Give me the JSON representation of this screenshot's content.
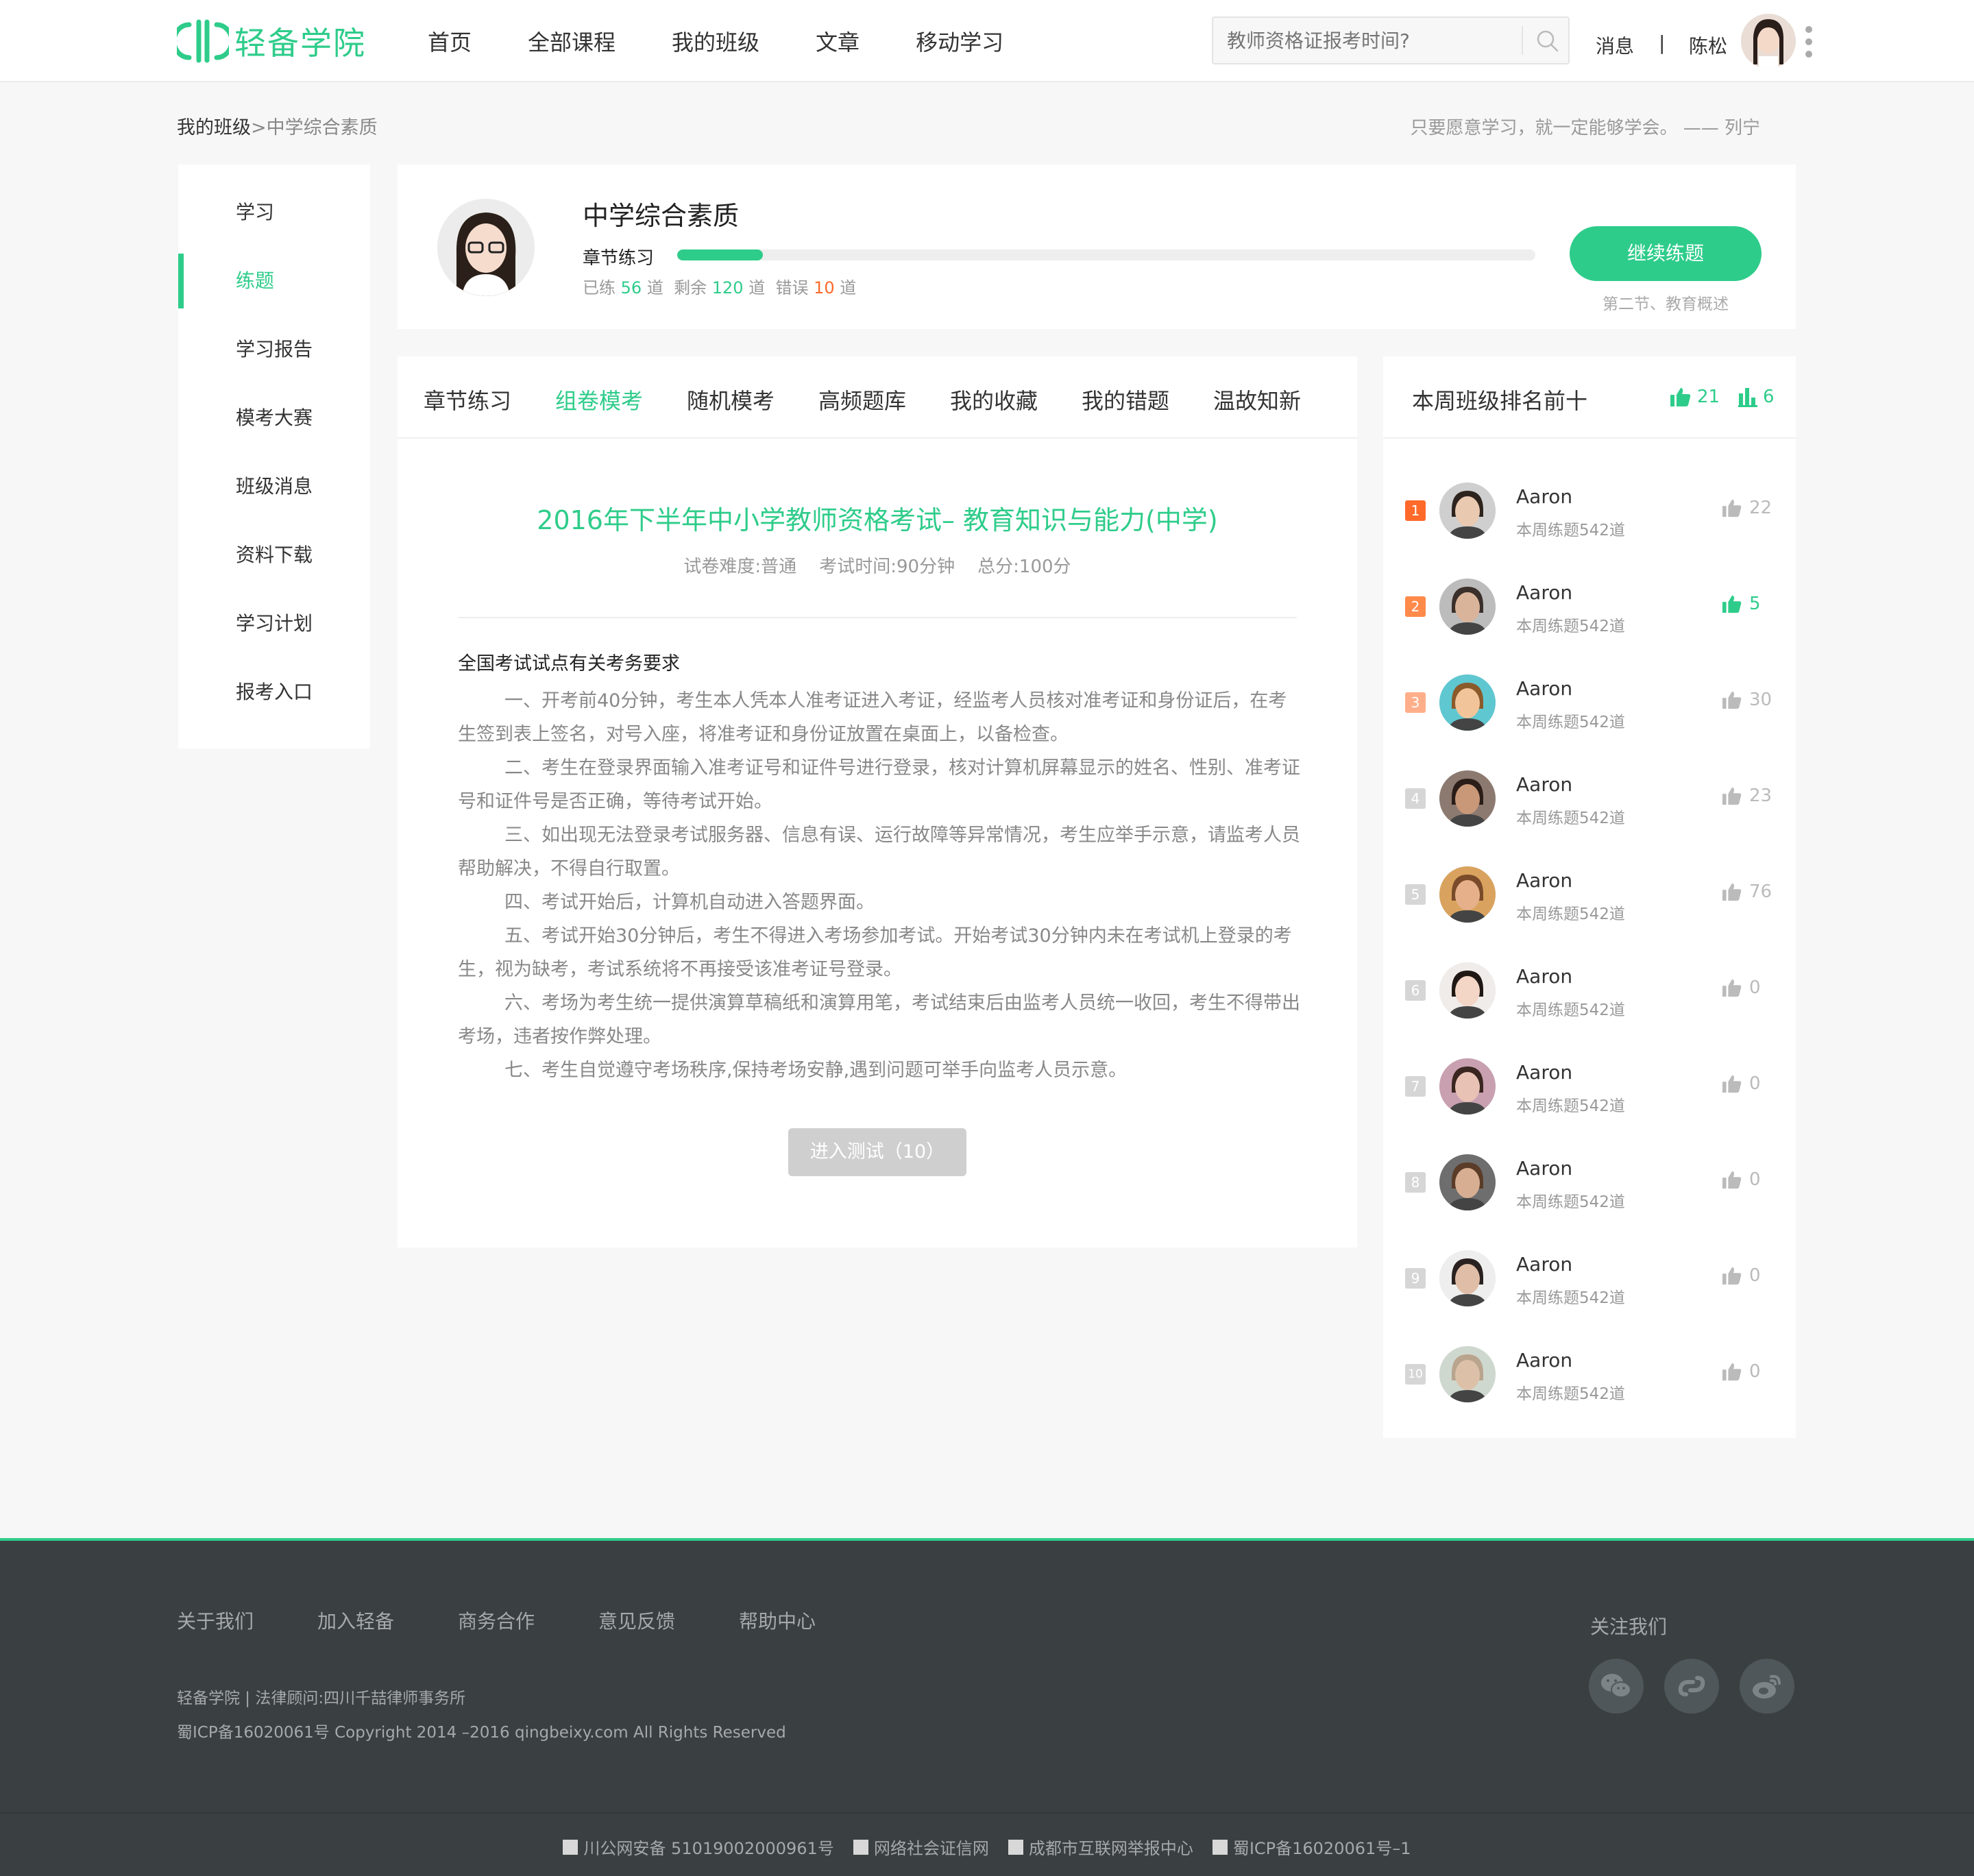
{
  "brand": {
    "name": "轻备学院",
    "color": "#2ecc8a"
  },
  "nav": {
    "items": [
      "首页",
      "全部课程",
      "我的班级",
      "文章",
      "移动学习"
    ]
  },
  "search": {
    "placeholder": "教师资格证报考时间?"
  },
  "header_user": {
    "messages": "消息",
    "separator": "|",
    "username": "陈松"
  },
  "breadcrumb": {
    "parent": "我的班级",
    "arrow": ">",
    "current": "中学综合素质"
  },
  "quote": "只要愿意学习，就一定能够学会。 —— 列宁",
  "sidebar": {
    "items": [
      "学习",
      "练题",
      "学习报告",
      "模考大赛",
      "班级消息",
      "资料下载",
      "学习计划",
      "报考入口"
    ],
    "active_index": 1
  },
  "course": {
    "title": "中学综合素质",
    "section_label": "章节练习",
    "progress_fraction": 0.1,
    "stats": {
      "done_label": "已练",
      "done": "56",
      "remain_label": "剩余",
      "remain": "120",
      "wrong_label": "错误",
      "wrong": "10",
      "unit": "道"
    },
    "continue_button": "继续练题",
    "hint": "第二节、教育概述"
  },
  "tabs": {
    "items": [
      "章节练习",
      "组卷模考",
      "随机模考",
      "高频题库",
      "我的收藏",
      "我的错题",
      "温故知新"
    ],
    "active_index": 1
  },
  "exam": {
    "title": "2016年下半年中小学教师资格考试– 教育知识与能力(中学)",
    "difficulty": "试卷难度:普通",
    "duration": "考试时间:90分钟",
    "total": "总分:100分",
    "notice_title": "全国考试试点有关考务要求",
    "notice_paragraphs": [
      "一、开考前40分钟，考生本人凭本人准考证进入考证，经监考人员核对准考证和身份证后，在考生签到表上签名，对号入座，将准考证和身份证放置在桌面上，以备检查。",
      "二、考生在登录界面输入准考证号和证件号进行登录，核对计算机屏幕显示的姓名、性别、准考证号和证件号是否正确，等待考试开始。",
      "三、如出现无法登录考试服务器、信息有误、运行故障等异常情况，考生应举手示意，请监考人员帮助解决，不得自行取置。",
      "四、考试开始后，计算机自动进入答题界面。",
      "五、考试开始30分钟后，考生不得进入考场参加考试。开始考试30分钟内未在考试机上登录的考生，视为缺考，考试系统将不再接受该准考证号登录。",
      "六、考场为考生统一提供演算草稿纸和演算用笔，考试结束后由监考人员统一收回，考生不得带出考场，违者按作弊处理。",
      "七、考生自觉遵守考场秩序,保持考场安静,遇到问题可举手向监考人员示意。"
    ],
    "enter_button": "进入测试（10）"
  },
  "ranking": {
    "title": "本周班级排名前十",
    "likes": "21",
    "rank_num": "6",
    "rows": [
      {
        "rank": "1",
        "name": "Aaron",
        "sub": "本周练题542道",
        "likes": "22",
        "liked": false,
        "badge_color": "#ff6a2a"
      },
      {
        "rank": "2",
        "name": "Aaron",
        "sub": "本周练题542道",
        "likes": "5",
        "liked": true,
        "badge_color": "#ff8a4a"
      },
      {
        "rank": "3",
        "name": "Aaron",
        "sub": "本周练题542道",
        "likes": "30",
        "liked": false,
        "badge_color": "#ffae8a"
      },
      {
        "rank": "4",
        "name": "Aaron",
        "sub": "本周练题542道",
        "likes": "23",
        "liked": false,
        "badge_color": "#d6d6d6"
      },
      {
        "rank": "5",
        "name": "Aaron",
        "sub": "本周练题542道",
        "likes": "76",
        "liked": false,
        "badge_color": "#d6d6d6"
      },
      {
        "rank": "6",
        "name": "Aaron",
        "sub": "本周练题542道",
        "likes": "0",
        "liked": false,
        "badge_color": "#d6d6d6"
      },
      {
        "rank": "7",
        "name": "Aaron",
        "sub": "本周练题542道",
        "likes": "0",
        "liked": false,
        "badge_color": "#d6d6d6"
      },
      {
        "rank": "8",
        "name": "Aaron",
        "sub": "本周练题542道",
        "likes": "0",
        "liked": false,
        "badge_color": "#d6d6d6"
      },
      {
        "rank": "9",
        "name": "Aaron",
        "sub": "本周练题542道",
        "likes": "0",
        "liked": false,
        "badge_color": "#d6d6d6"
      },
      {
        "rank": "10",
        "name": "Aaron",
        "sub": "本周练题542道",
        "likes": "0",
        "liked": false,
        "badge_color": "#d6d6d6"
      }
    ]
  },
  "footer": {
    "links": [
      "关于我们",
      "加入轻备",
      "商务合作",
      "意见反馈",
      "帮助中心"
    ],
    "line1": "轻备学院 | 法律顾问:四川千喆律师事务所",
    "line2": "蜀ICP备16020061号 Copyright 2014 –2016 qingbeixy.com All Rights Reserved",
    "follow": "关注我们",
    "social_icons": [
      "wechat-icon",
      "link-icon",
      "weibo-icon"
    ],
    "bottom": [
      "川公网安备 51019002000961号",
      "网络社会证信网",
      "成都市互联网举报中心",
      "蜀ICP备16020061号–1"
    ],
    "bg_color": "#3a3f42"
  }
}
